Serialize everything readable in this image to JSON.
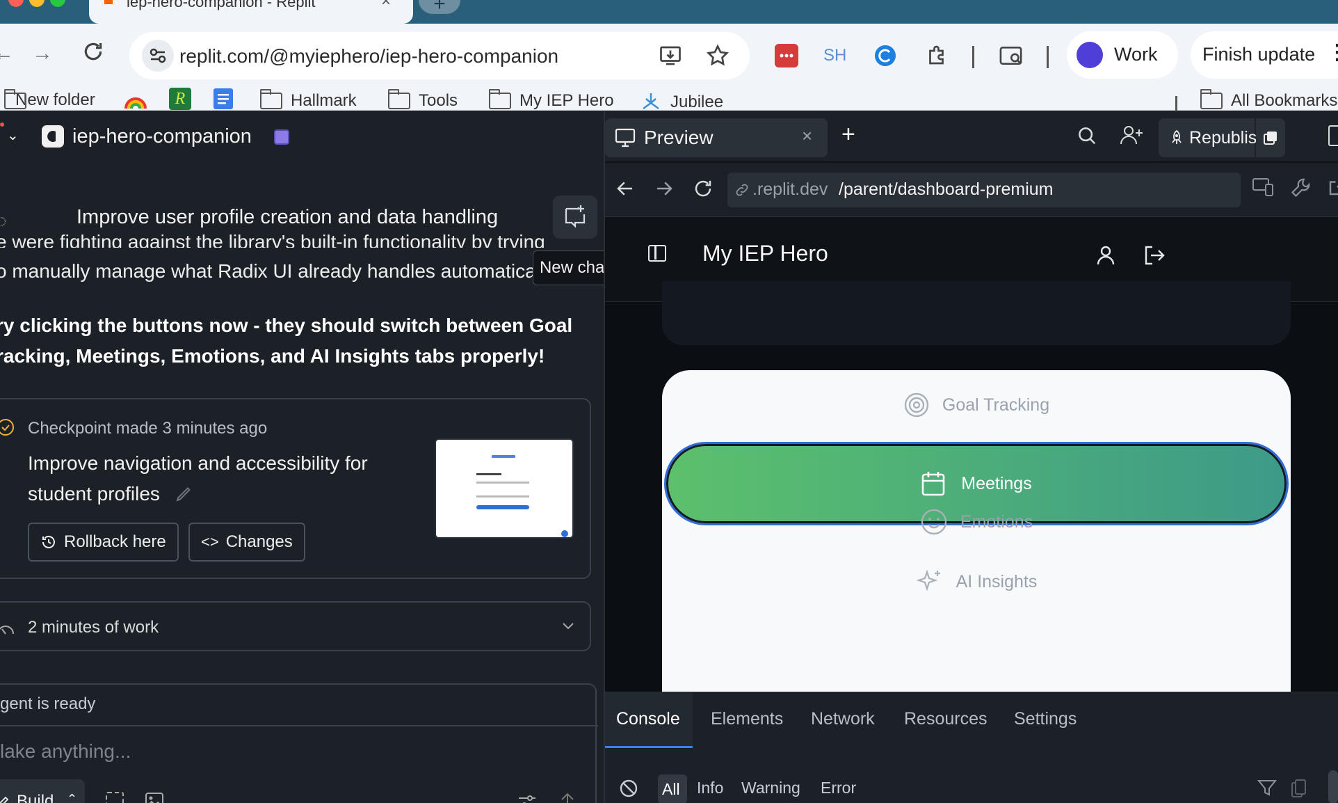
{
  "browser": {
    "tab_title": "iep-hero-companion - Replit",
    "url": "replit.com/@myiephero/iep-hero-companion",
    "profile_label": "Work",
    "update_label": "Finish update",
    "ext_sh_label": "SH",
    "bookmarks": [
      "New folder",
      "Hallmark",
      "Tools",
      "My IEP Hero",
      "Jubilee"
    ],
    "all_bookmarks": "All Bookmarks"
  },
  "agent": {
    "project_name": "iep-hero-companion",
    "chat_title": "Improve user profile creation and data handling",
    "new_chat_tooltip": "New chat",
    "message_line1": "e were fighting against the library's built-in functionality by trying",
    "message_line2": "o manually manage what Radix UI already handles automatically.",
    "bold_line1": "ry clicking the buttons now - they should switch between Goal",
    "bold_line2": "racking, Meetings, Emotions, and AI Insights tabs properly!",
    "checkpoint_status": "Checkpoint made",
    "checkpoint_time": "3 minutes ago",
    "checkpoint_title_line1": "Improve navigation and accessibility for",
    "checkpoint_title_line2": "student profiles",
    "rollback_label": "Rollback here",
    "changes_label": "Changes",
    "work_duration": "2 minutes of work",
    "agent_status": "gent is ready",
    "composer_placeholder": "lake anything...",
    "build_label": "Build"
  },
  "preview": {
    "tab_label": "Preview",
    "republish_label": "Republish",
    "url_domain": ".replit.dev",
    "url_path": "/parent/dashboard-premium",
    "app_title": "My IEP Hero",
    "nav_tabs": [
      "Goal Tracking",
      "Meetings",
      "Emotions",
      "AI Insights"
    ],
    "active_tab": "Meetings"
  },
  "devtools": {
    "tabs": [
      "Console",
      "Elements",
      "Network",
      "Resources",
      "Settings"
    ],
    "active_tab": "Console",
    "filters": [
      "All",
      "Info",
      "Warning",
      "Error"
    ],
    "active_filter": "All"
  },
  "colors": {
    "tabstrip": "#2a5f79",
    "meetings_gradient_start": "#5cc06c",
    "meetings_gradient_end": "#3d9a88",
    "focus_ring": "#2f6dd9"
  }
}
